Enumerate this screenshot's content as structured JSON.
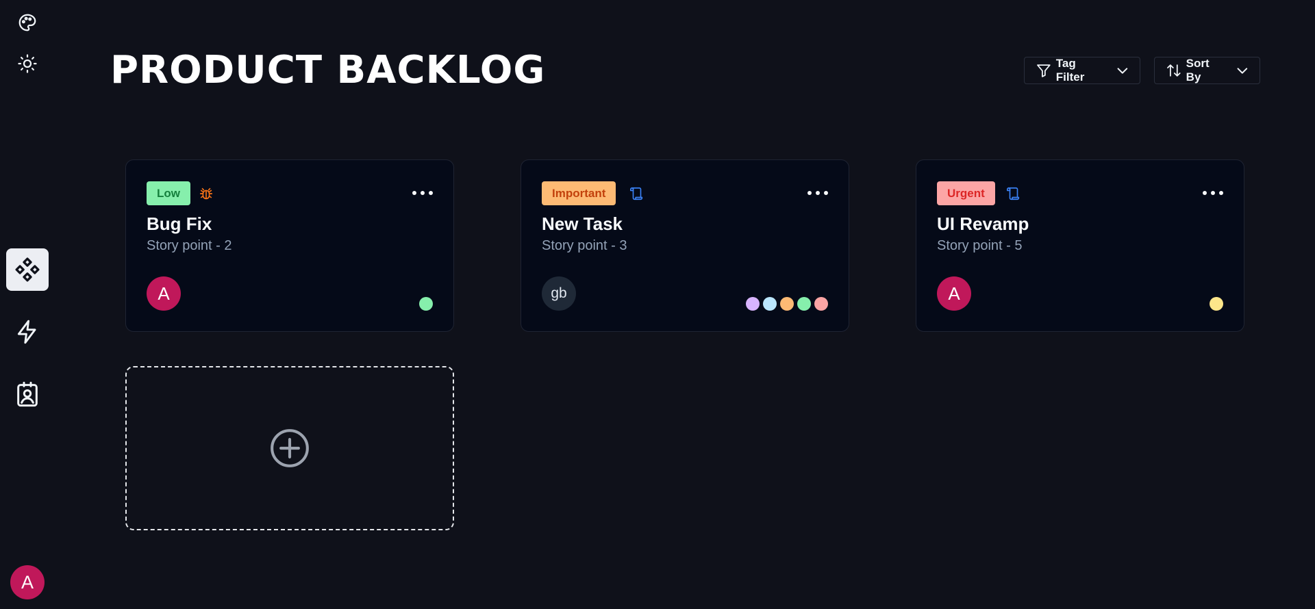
{
  "header": {
    "title": "PRODUCT BACKLOG",
    "tag_filter_label": "Tag Filter",
    "sort_by_label": "Sort By"
  },
  "sidebar": {
    "items": [
      {
        "name": "palette-icon"
      },
      {
        "name": "sun-icon"
      },
      {
        "name": "backlog-icon",
        "active": true
      },
      {
        "name": "lightning-icon"
      },
      {
        "name": "contact-icon"
      }
    ],
    "user_initial": "A"
  },
  "cards": [
    {
      "priority": "Low",
      "priority_bg": "#86efac",
      "priority_fg": "#15803d",
      "type_icon": "bug-icon",
      "type_color": "#f97316",
      "title": "Bug Fix",
      "story_points": "Story point - 2",
      "assignee": "A",
      "assignee_color": "#c0185a",
      "tag_dots": [
        "#86efac"
      ]
    },
    {
      "priority": "Important",
      "priority_bg": "#fdba74",
      "priority_fg": "#c2410c",
      "type_icon": "scroll-icon",
      "type_color": "#3b82f6",
      "title": "New Task",
      "story_points": "Story point - 3",
      "assignee": "gb",
      "assignee_color": "#1f2937",
      "tag_dots": [
        "#d8b4fe",
        "#bae6fd",
        "#fdba74",
        "#86efac",
        "#fca5a5"
      ]
    },
    {
      "priority": "Urgent",
      "priority_bg": "#fca5a5",
      "priority_fg": "#dc2626",
      "type_icon": "scroll-icon",
      "type_color": "#3b82f6",
      "title": "UI Revamp",
      "story_points": "Story point - 5",
      "assignee": "A",
      "assignee_color": "#c0185a",
      "tag_dots": [
        "#fde68a"
      ]
    }
  ],
  "add_card": {
    "icon": "plus-circle-icon"
  }
}
